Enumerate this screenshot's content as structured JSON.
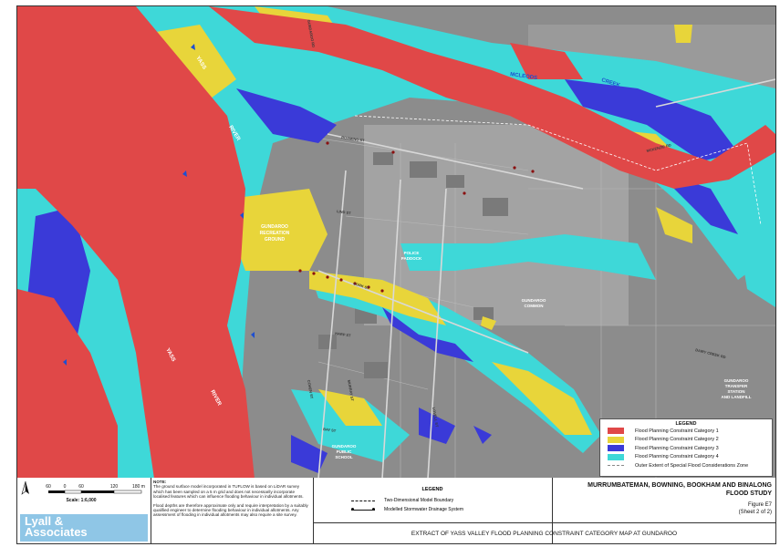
{
  "map": {
    "labels": {
      "yass_river_top": "YASS",
      "river_top": "RIVER",
      "yass_river_bottom": "YASS",
      "river_bottom": "RIVER",
      "mcleods": "MCLEODS",
      "creek": "CREEK",
      "recreation_ground": [
        "GUNDAROO",
        "RECREATION",
        "GROUND"
      ],
      "police_paddock": [
        "POLICE",
        "PADDOCK"
      ],
      "common": [
        "GUNDAROO",
        "COMMON"
      ],
      "transfer_station": [
        "GUNDAROO",
        "TRANSFER",
        "STATION",
        "AND LANDFILL"
      ],
      "public_school": [
        "GUNDAROO",
        "PUBLIC",
        "SCHOOL"
      ],
      "roads": {
        "roaming_st": "ROAMING ST",
        "lind_st": "LIND ST",
        "cork_st": "CORK ST",
        "harp_st": "HARP ST",
        "bay_st": "BAY ST",
        "murray_st": "MURRAY ST",
        "cohen_st": "COHEN ST",
        "gundaroo_rd": "GUNDAROO RD",
        "dairy_creek_rd": "DAIRY CREEK RD",
        "mckenzie_rd": "MCKENZIE RD",
        "lovell_st": "LOVELL ST"
      }
    }
  },
  "legend": {
    "title": "LEGEND",
    "items": [
      {
        "label": "Flood Planning Constraint Category 1",
        "color": "#e04848"
      },
      {
        "label": "Flood Planning Constraint Category 2",
        "color": "#e8d53a"
      },
      {
        "label": "Flood Planning Constraint Category 3",
        "color": "#3a3ad8"
      },
      {
        "label": "Flood Planning Constraint Category 4",
        "color": "#3ed8d8"
      },
      {
        "label": "Outer Extent of Special Flood Considerations Zone",
        "color": "#999999"
      }
    ]
  },
  "scale": {
    "ticks": [
      "60",
      "0",
      "60",
      "120",
      "180 m"
    ],
    "text": "Scale: 1:6,000"
  },
  "note": {
    "heading": "NOTE:",
    "p1": "The ground surface model incorporated in TUFLOW is based on LiDAR survey which has been sampled on a 5 m grid and does not necessarily incorporate localised features which can influence flooding behaviour in individual allotments.",
    "p2": "Flood depths are therefore approximate only and require interpretation by a suitably qualified engineer to determine flooding behaviour in individual allotments. Any assessment of flooding in individual allotments may also require a site survey."
  },
  "legend2": {
    "title": "LEGEND",
    "items": [
      "Two-Dimensional Model Boundary",
      "Modelled Stormwater Drainage System"
    ]
  },
  "company": {
    "name_line1": "Lyall &",
    "name_line2": "Associates"
  },
  "title_block": {
    "line1": "MURRUMBATEMAN, BOWNING, BOOKHAM AND BINALONG",
    "line2": "FLOOD STUDY",
    "figure": "Figure E7",
    "sheet": "(Sheet 2 of 2)",
    "caption": "EXTRACT OF YASS VALLEY FLOOD PLANNING CONSTRAINT CATEGORY MAP AT GUNDAROO"
  }
}
